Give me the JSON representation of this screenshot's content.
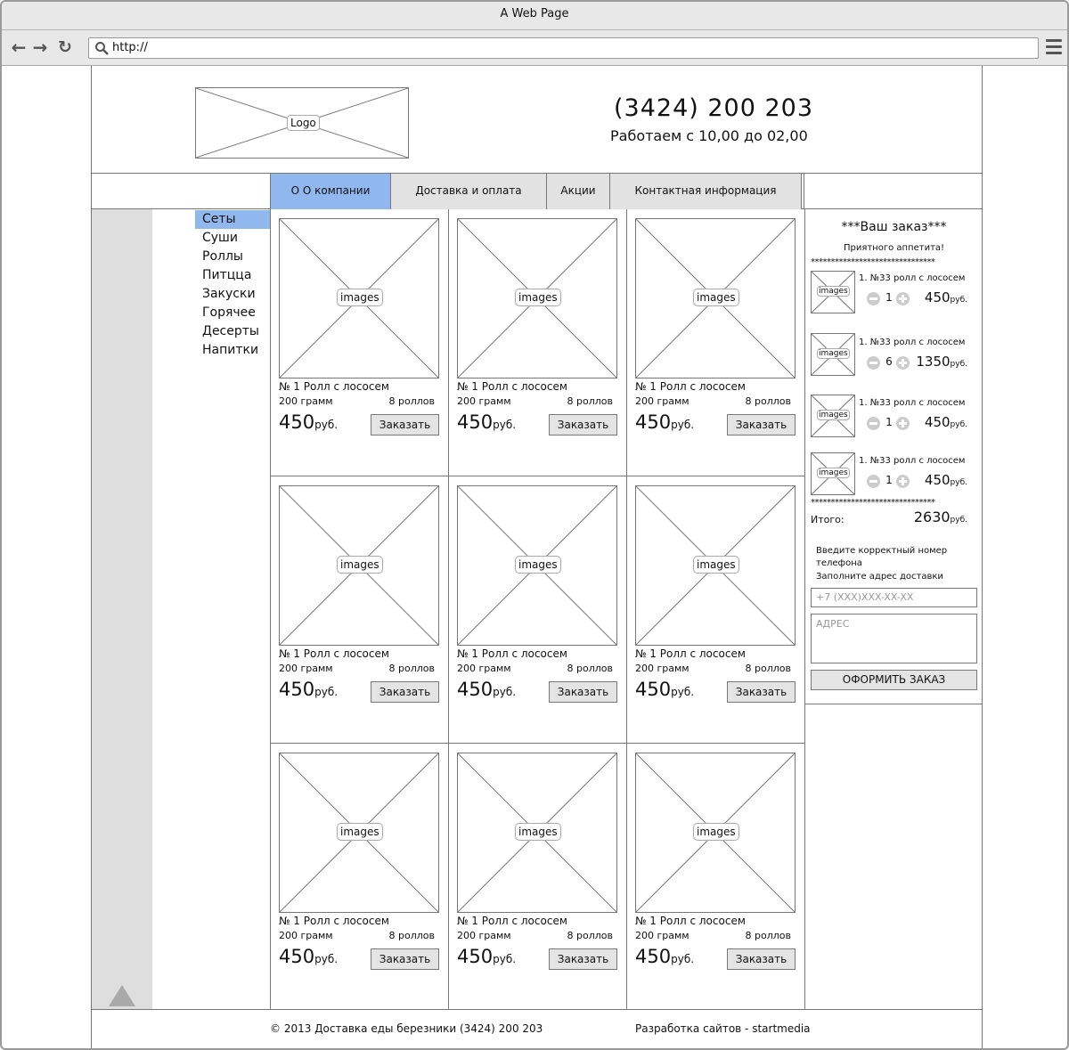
{
  "browser": {
    "title": "A Web Page",
    "url": "http://"
  },
  "header": {
    "logo_label": "Logo",
    "phone": "(3424) 200 203",
    "hours": "Работаем с 10,00 до 02,00"
  },
  "nav": {
    "tabs": [
      {
        "label": "О О компании",
        "active": true
      },
      {
        "label": "Доставка и оплата",
        "active": false
      },
      {
        "label": "Акции",
        "active": false
      },
      {
        "label": "Контактная информация",
        "active": false
      }
    ]
  },
  "sidebar": {
    "categories": [
      {
        "label": "Сеты",
        "active": true
      },
      {
        "label": "Суши",
        "active": false
      },
      {
        "label": "Роллы",
        "active": false
      },
      {
        "label": "Питцца",
        "active": false
      },
      {
        "label": "Закуски",
        "active": false
      },
      {
        "label": "Горячее",
        "active": false
      },
      {
        "label": "Десерты",
        "active": false
      },
      {
        "label": "Напитки",
        "active": false
      }
    ]
  },
  "products": [
    {
      "image_label": "images",
      "name": "№ 1 Ролл с лососем",
      "weight": "200 грамм",
      "count": "8 роллов",
      "price": "450",
      "currency": "руб.",
      "button": "Заказать"
    },
    {
      "image_label": "images",
      "name": "№ 1 Ролл с лососем",
      "weight": "200 грамм",
      "count": "8 роллов",
      "price": "450",
      "currency": "руб.",
      "button": "Заказать"
    },
    {
      "image_label": "images",
      "name": "№ 1 Ролл с лососем",
      "weight": "200 грамм",
      "count": "8 роллов",
      "price": "450",
      "currency": "руб.",
      "button": "Заказать"
    },
    {
      "image_label": "images",
      "name": "№ 1 Ролл с лососем",
      "weight": "200 грамм",
      "count": "8 роллов",
      "price": "450",
      "currency": "руб.",
      "button": "Заказать"
    },
    {
      "image_label": "images",
      "name": "№ 1 Ролл с лососем",
      "weight": "200 грамм",
      "count": "8 роллов",
      "price": "450",
      "currency": "руб.",
      "button": "Заказать"
    },
    {
      "image_label": "images",
      "name": "№ 1 Ролл с лососем",
      "weight": "200 грамм",
      "count": "8 роллов",
      "price": "450",
      "currency": "руб.",
      "button": "Заказать"
    },
    {
      "image_label": "images",
      "name": "№ 1 Ролл с лососем",
      "weight": "200 грамм",
      "count": "8 роллов",
      "price": "450",
      "currency": "руб.",
      "button": "Заказать"
    },
    {
      "image_label": "images",
      "name": "№ 1 Ролл с лососем",
      "weight": "200 грамм",
      "count": "8 роллов",
      "price": "450",
      "currency": "руб.",
      "button": "Заказать"
    },
    {
      "image_label": "images",
      "name": "№ 1 Ролл с лососем",
      "weight": "200 грамм",
      "count": "8 роллов",
      "price": "450",
      "currency": "руб.",
      "button": "Заказать"
    }
  ],
  "order": {
    "title": "***Ваш заказ***",
    "subtitle": "Приятного аппетита!",
    "separator": "*******************************",
    "items": [
      {
        "image_label": "images",
        "name": "1. №33 ролл с лососем",
        "qty": "1",
        "price": "450",
        "currency": "руб."
      },
      {
        "image_label": "images",
        "name": "1. №33 ролл с лососем",
        "qty": "6",
        "price": "1350",
        "currency": "руб."
      },
      {
        "image_label": "images",
        "name": "1. №33 ролл с лососем",
        "qty": "1",
        "price": "450",
        "currency": "руб."
      },
      {
        "image_label": "images",
        "name": "1. №33 ролл с лососем",
        "qty": "1",
        "price": "450",
        "currency": "руб."
      }
    ],
    "total_label": "Итого:",
    "total_value": "2630",
    "total_currency": "руб.",
    "hint_phone_1": "Введите корректный номер",
    "hint_phone_2": "телефона",
    "hint_address": "Заполните адрес доставки",
    "phone_placeholder": "+7 (XXX)XXX-XX-XX",
    "address_placeholder": "АДРЕС",
    "submit_label": "ОФОРМИТЬ ЗАКАЗ"
  },
  "footer": {
    "copyright": "© 2013 Доставка еды березники (3424) 200 203",
    "developer": "Разработка сайтов - startmedia"
  },
  "colors": {
    "active_highlight": "#91b7ef",
    "button_bg": "#e4e4e4",
    "sidebar_strip": "#dedede"
  }
}
